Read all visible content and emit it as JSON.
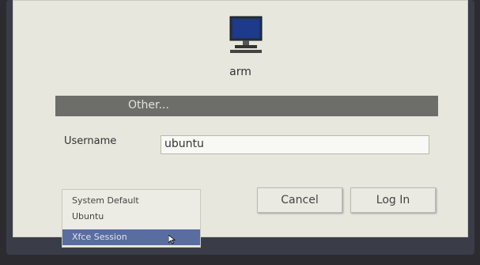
{
  "login": {
    "host": "arm",
    "user_list": {
      "selected_label": "Other..."
    },
    "username": {
      "label": "Username",
      "value": "ubuntu"
    },
    "buttons": {
      "cancel": "Cancel",
      "login": "Log In"
    },
    "sessions": {
      "items": [
        "System Default",
        "Ubuntu",
        "Xfce Session"
      ],
      "selected": "Xfce Session"
    }
  },
  "colors": {
    "dialog_bg": "#e7e7de",
    "user_bar": "#6d6d6a",
    "selection": "#5a6da0",
    "monitor": "#1e3a8a"
  },
  "icons": {
    "computer": "computer-icon",
    "pointer": "mouse-pointer-icon"
  }
}
